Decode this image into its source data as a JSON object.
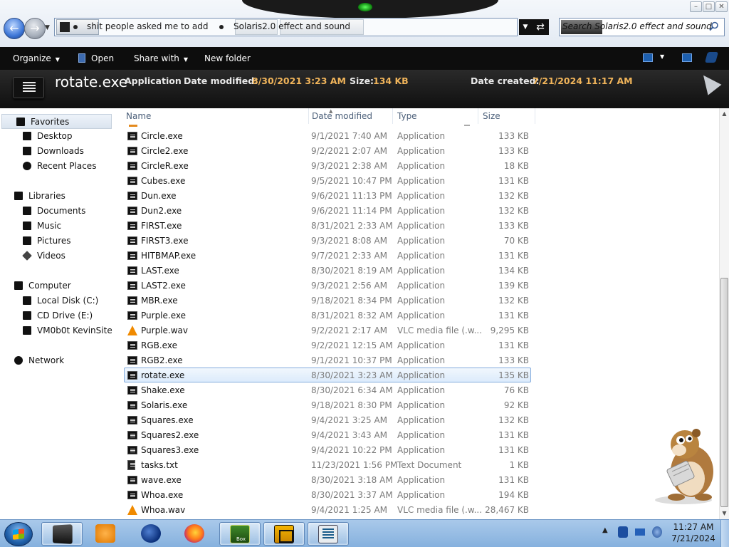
{
  "window": {
    "controls": [
      "–",
      "□",
      "✕"
    ]
  },
  "address": {
    "segments": [
      "shit people asked me to add",
      "Solaris2.0 effect and sound"
    ],
    "search_placeholder": "Search Solaris2.0 effect and sound"
  },
  "toolbar": {
    "organize": "Organize",
    "open": "Open",
    "share_with": "Share with",
    "new_folder": "New folder"
  },
  "details": {
    "name": "rotate.exe",
    "type": "Application",
    "date_modified_label": "Date modified:",
    "date_modified": "8/30/2021 3:23 AM",
    "size_label": "Size:",
    "size": "134 KB",
    "date_created_label": "Date created:",
    "date_created": "7/21/2024 11:17 AM"
  },
  "nav": {
    "favorites": "Favorites",
    "desktop": "Desktop",
    "downloads": "Downloads",
    "recent": "Recent Places",
    "libraries": "Libraries",
    "documents": "Documents",
    "music": "Music",
    "pictures": "Pictures",
    "videos": "Videos",
    "computer": "Computer",
    "local_disk": "Local Disk (C:)",
    "cd_drive": "CD Drive (E:)",
    "vm_share": "VM0b0t KevinSite",
    "network": "Network"
  },
  "columns": {
    "name": "Name",
    "date": "Date modified",
    "type": "Type",
    "size": "Size"
  },
  "files": [
    {
      "name": "Circle.exe",
      "date": "9/1/2021 7:40 AM",
      "type": "Application",
      "size": "133 KB",
      "icon": "exe"
    },
    {
      "name": "Circle2.exe",
      "date": "9/2/2021 2:07 AM",
      "type": "Application",
      "size": "133 KB",
      "icon": "exe"
    },
    {
      "name": "CircleR.exe",
      "date": "9/3/2021 2:38 AM",
      "type": "Application",
      "size": "18 KB",
      "icon": "exe"
    },
    {
      "name": "Cubes.exe",
      "date": "9/5/2021 10:47 PM",
      "type": "Application",
      "size": "131 KB",
      "icon": "exe"
    },
    {
      "name": "Dun.exe",
      "date": "9/6/2021 11:13 PM",
      "type": "Application",
      "size": "132 KB",
      "icon": "exe"
    },
    {
      "name": "Dun2.exe",
      "date": "9/6/2021 11:14 PM",
      "type": "Application",
      "size": "132 KB",
      "icon": "exe"
    },
    {
      "name": "FIRST.exe",
      "date": "8/31/2021 2:33 AM",
      "type": "Application",
      "size": "133 KB",
      "icon": "exe"
    },
    {
      "name": "FIRST3.exe",
      "date": "9/3/2021 8:08 AM",
      "type": "Application",
      "size": "70 KB",
      "icon": "exe"
    },
    {
      "name": "HITBMAP.exe",
      "date": "9/7/2021 2:33 AM",
      "type": "Application",
      "size": "131 KB",
      "icon": "exe"
    },
    {
      "name": "LAST.exe",
      "date": "8/30/2021 8:19 AM",
      "type": "Application",
      "size": "134 KB",
      "icon": "exe"
    },
    {
      "name": "LAST2.exe",
      "date": "9/3/2021 2:56 AM",
      "type": "Application",
      "size": "139 KB",
      "icon": "exe"
    },
    {
      "name": "MBR.exe",
      "date": "9/18/2021 8:34 PM",
      "type": "Application",
      "size": "132 KB",
      "icon": "exe"
    },
    {
      "name": "Purple.exe",
      "date": "8/31/2021 8:32 AM",
      "type": "Application",
      "size": "131 KB",
      "icon": "exe"
    },
    {
      "name": "Purple.wav",
      "date": "9/2/2021 2:17 AM",
      "type": "VLC media file (.w...",
      "size": "9,295 KB",
      "icon": "vlc"
    },
    {
      "name": "RGB.exe",
      "date": "9/2/2021 12:15 AM",
      "type": "Application",
      "size": "131 KB",
      "icon": "exe"
    },
    {
      "name": "RGB2.exe",
      "date": "9/1/2021 10:37 PM",
      "type": "Application",
      "size": "133 KB",
      "icon": "exe"
    },
    {
      "name": "rotate.exe",
      "date": "8/30/2021 3:23 AM",
      "type": "Application",
      "size": "135 KB",
      "icon": "exe",
      "selected": true
    },
    {
      "name": "Shake.exe",
      "date": "8/30/2021 6:34 AM",
      "type": "Application",
      "size": "76 KB",
      "icon": "exe"
    },
    {
      "name": "Solaris.exe",
      "date": "9/18/2021 8:30 PM",
      "type": "Application",
      "size": "92 KB",
      "icon": "exe"
    },
    {
      "name": "Squares.exe",
      "date": "9/4/2021 3:25 AM",
      "type": "Application",
      "size": "132 KB",
      "icon": "exe"
    },
    {
      "name": "Squares2.exe",
      "date": "9/4/2021 3:43 AM",
      "type": "Application",
      "size": "131 KB",
      "icon": "exe"
    },
    {
      "name": "Squares3.exe",
      "date": "9/4/2021 10:22 PM",
      "type": "Application",
      "size": "131 KB",
      "icon": "exe"
    },
    {
      "name": "tasks.txt",
      "date": "11/23/2021 1:56 PM",
      "type": "Text Document",
      "size": "1 KB",
      "icon": "txt"
    },
    {
      "name": "wave.exe",
      "date": "8/30/2021 3:18 AM",
      "type": "Application",
      "size": "131 KB",
      "icon": "exe"
    },
    {
      "name": "Whoa.exe",
      "date": "8/30/2021 3:37 AM",
      "type": "Application",
      "size": "194 KB",
      "icon": "exe"
    },
    {
      "name": "Whoa.wav",
      "date": "9/4/2021 1:25 AM",
      "type": "VLC media file (.w...",
      "size": "28,467 KB",
      "icon": "vlc"
    }
  ],
  "taskbar": {
    "box_label": "Box",
    "time": "11:27 AM",
    "date": "7/21/2024",
    "apps": [
      "explorer-icon",
      "media-player-icon",
      "globe-icon",
      "firefox-icon",
      "box-icon",
      "vm-icon",
      "window-icon"
    ]
  },
  "colors": {
    "toolbar_bg": "#0d0d0d",
    "details_value": "#f0b45a",
    "selection": "#dcebfc",
    "taskbar": "#9cbfe3"
  }
}
